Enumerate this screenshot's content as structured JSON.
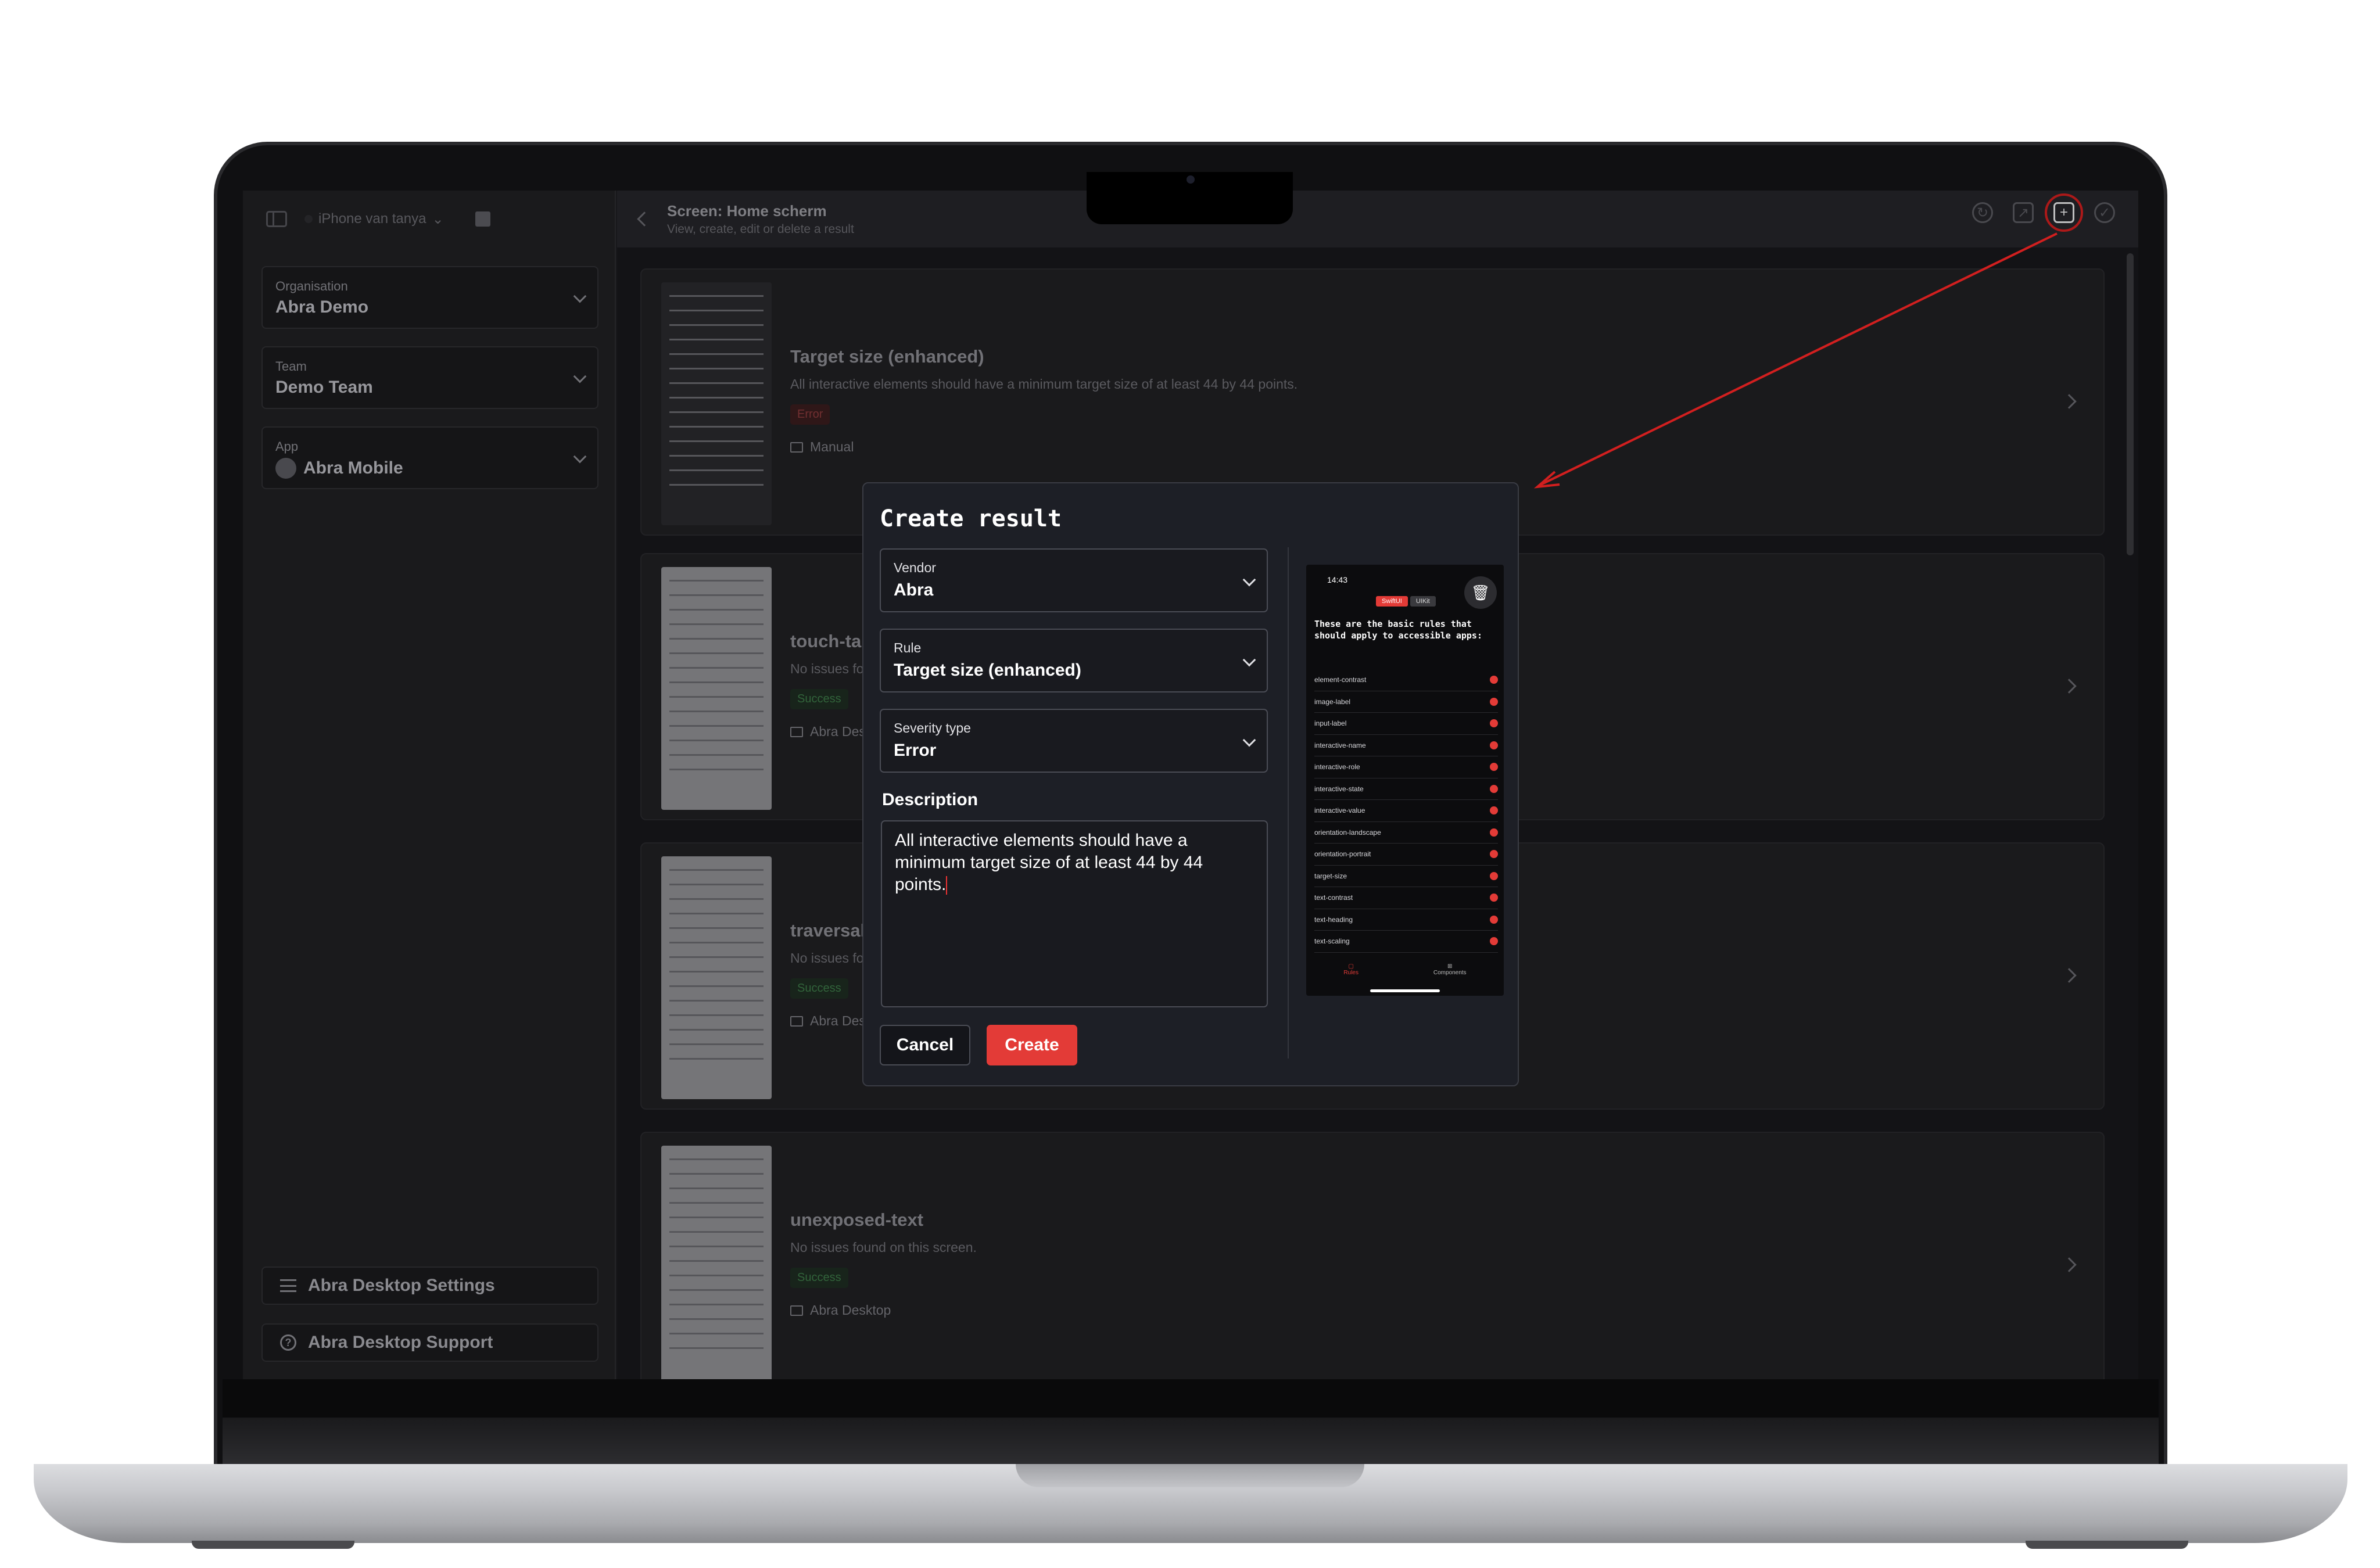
{
  "sidebar": {
    "device": "iPhone van tanya",
    "organisation": {
      "label": "Organisation",
      "value": "Abra Demo"
    },
    "team": {
      "label": "Team",
      "value": "Demo Team"
    },
    "app": {
      "label": "App",
      "value": "Abra Mobile"
    },
    "settings_label": "Abra Desktop Settings",
    "support_label": "Abra Desktop Support"
  },
  "header": {
    "title": "Screen: Home scherm",
    "subtitle": "View, create, edit or delete a result"
  },
  "results": [
    {
      "title": "Target size (enhanced)",
      "description": "All interactive elements should have a minimum target size of at least 44 by 44 points.",
      "status": "Error",
      "source": "Manual"
    },
    {
      "title": "touch-target",
      "description": "No issues found on this screen.",
      "status": "Success",
      "source": "Abra Desktop"
    },
    {
      "title": "traversal",
      "description": "No issues found on this screen.",
      "status": "Success",
      "source": "Abra Desktop"
    },
    {
      "title": "unexposed-text",
      "description": "No issues found on this screen.",
      "status": "Success",
      "source": "Abra Desktop"
    }
  ],
  "modal": {
    "title": "Create result",
    "vendor": {
      "label": "Vendor",
      "value": "Abra"
    },
    "rule": {
      "label": "Rule",
      "value": "Target size (enhanced)"
    },
    "severity": {
      "label": "Severity type",
      "value": "Error"
    },
    "description_label": "Description",
    "description_value": "All interactive elements should have a minimum target size of at least 44 by 44 points.",
    "cancel_label": "Cancel",
    "create_label": "Create"
  },
  "preview": {
    "time": "14:43",
    "segments": [
      "SwiftUI",
      "UIKit"
    ],
    "heading": "These are the basic rules that should apply to accessible apps:",
    "rules": [
      "element-contrast",
      "image-label",
      "input-label",
      "interactive-name",
      "interactive-role",
      "interactive-state",
      "interactive-value",
      "orientation-landscape",
      "orientation-portrait",
      "target-size",
      "text-contrast",
      "text-heading",
      "text-scaling"
    ],
    "tabs": [
      "Rules",
      "Components"
    ]
  },
  "colors": {
    "accent": "#e33b37",
    "annotation": "#d21f1f",
    "error_badge": "#8b3a3c",
    "success_badge": "#3d7a48"
  }
}
